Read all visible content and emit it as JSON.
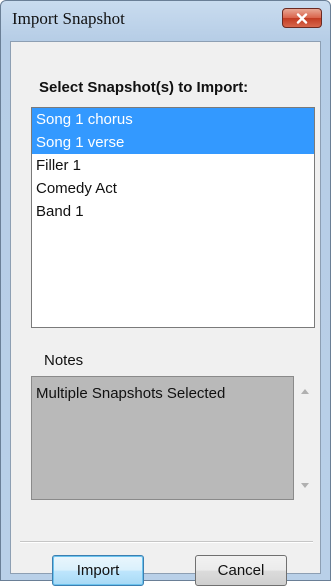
{
  "window": {
    "title": "Import Snapshot",
    "close_icon": "close-x-icon"
  },
  "dialog": {
    "heading": "Select Snapshot(s) to Import:",
    "snapshots": [
      {
        "label": "Song 1 chorus",
        "selected": true
      },
      {
        "label": "Song 1 verse",
        "selected": true
      },
      {
        "label": "Filler 1",
        "selected": false
      },
      {
        "label": "Comedy Act",
        "selected": false
      },
      {
        "label": "Band 1",
        "selected": false
      }
    ],
    "notes_label": "Notes",
    "notes_text": "Multiple Snapshots Selected",
    "import_label": "Import",
    "cancel_label": "Cancel"
  },
  "colors": {
    "selection": "#3399ff",
    "notes_background": "#b9b9b9",
    "close_button": "#c23b22"
  }
}
